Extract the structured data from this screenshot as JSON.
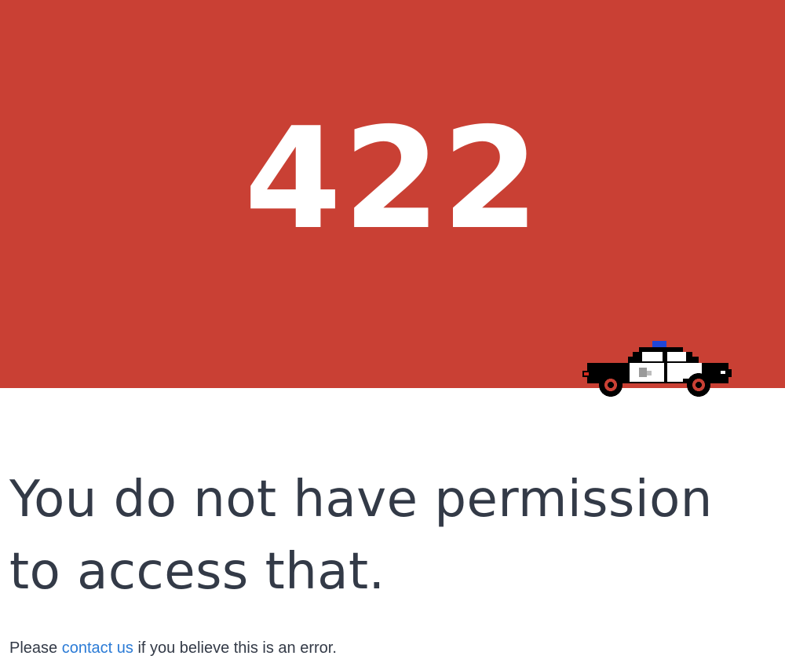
{
  "hero": {
    "error_code": "422",
    "background_color": "#c94034"
  },
  "illustration": {
    "icon": "police-car-icon"
  },
  "message": {
    "headline": "You do not have permission to access that.",
    "note_before_link": "Please ",
    "link_label": "contact us",
    "note_after_link": " if you believe this is an error.",
    "link_color": "#2b7bd6",
    "text_color": "#333a47"
  }
}
